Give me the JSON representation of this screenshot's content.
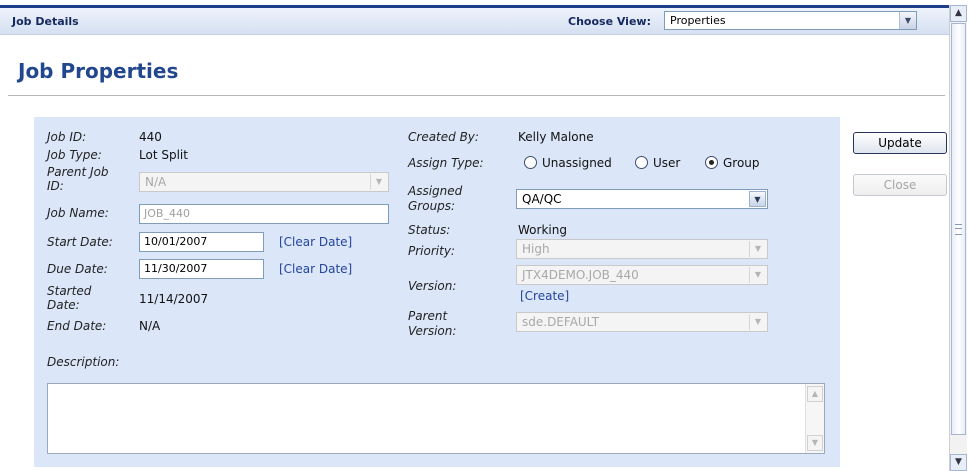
{
  "header": {
    "title": "Job Details",
    "view_label": "Choose View:",
    "view_value": "Properties"
  },
  "page_title": "Job Properties",
  "left": {
    "job_id_label": "Job ID:",
    "job_id": "440",
    "job_type_label": "Job Type:",
    "job_type": "Lot Split",
    "parent_job_id_label_1": "Parent Job",
    "parent_job_id_label_2": "ID:",
    "parent_job_id": "N/A",
    "job_name_label": "Job Name:",
    "job_name": "JOB_440",
    "start_date_label": "Start Date:",
    "start_date": "10/01/2007",
    "due_date_label": "Due Date:",
    "due_date": "11/30/2007",
    "clear_date": "[Clear Date]",
    "started_date_label_1": "Started",
    "started_date_label_2": "Date:",
    "started_date": "11/14/2007",
    "end_date_label": "End Date:",
    "end_date": "N/A",
    "description_label": "Description:"
  },
  "right": {
    "created_by_label": "Created By:",
    "created_by": "Kelly Malone",
    "assign_type_label": "Assign Type:",
    "assign_options": [
      "Unassigned",
      "User",
      "Group"
    ],
    "assigned_groups_label_1": "Assigned",
    "assigned_groups_label_2": "Groups:",
    "assigned_groups": "QA/QC",
    "status_label": "Status:",
    "status": "Working",
    "priority_label": "Priority:",
    "priority": "High",
    "version_label": "Version:",
    "version": "JTX4DEMO.JOB_440",
    "create_link": "[Create]",
    "parent_version_label_1": "Parent",
    "parent_version_label_2": "Version:",
    "parent_version": "sde.DEFAULT"
  },
  "buttons": {
    "update": "Update",
    "close": "Close"
  }
}
